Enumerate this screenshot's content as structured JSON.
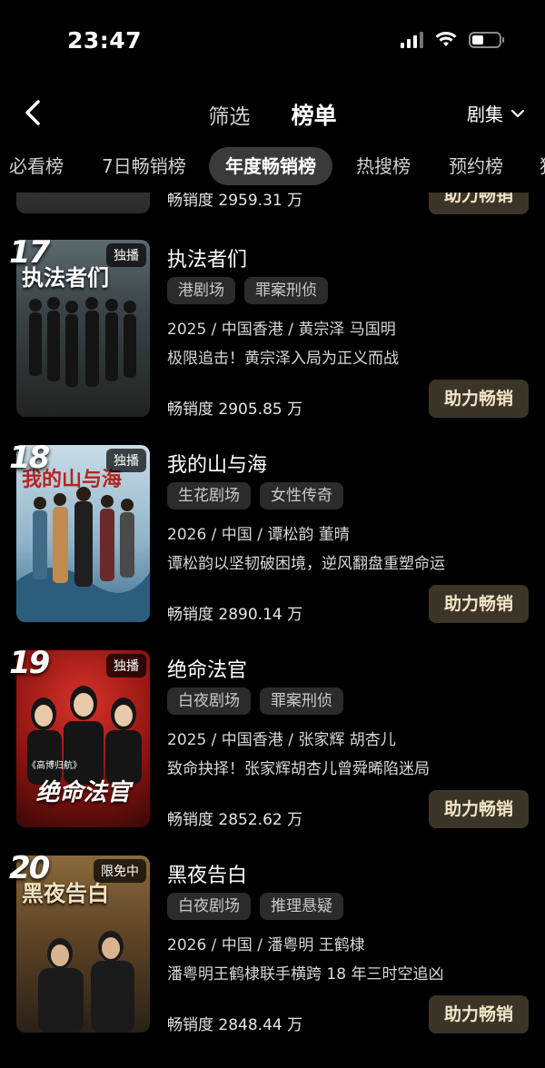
{
  "status": {
    "time": "23:47"
  },
  "nav": {
    "filter": "筛选",
    "title": "榜单",
    "category": "剧集"
  },
  "tabs": [
    "必看榜",
    "7日畅销榜",
    "年度畅销榜",
    "热搜榜",
    "预约榜",
    "猜"
  ],
  "partial_item": {
    "sales": "畅销度 2959.31 万",
    "button": "助力畅销"
  },
  "items": [
    {
      "rank": "17",
      "badge": "独播",
      "poster_text": "执法者们",
      "title": "执法者们",
      "tags": [
        "港剧场",
        "罪案刑侦"
      ],
      "meta": "2025 / 中国香港 / 黄宗泽  马国明",
      "desc": "极限追击！黄宗泽入局为正义而战",
      "sales": "畅销度 2905.85 万",
      "button": "助力畅销"
    },
    {
      "rank": "18",
      "badge": "独播",
      "poster_text": "我的山与海",
      "title": "我的山与海",
      "tags": [
        "生花剧场",
        "女性传奇"
      ],
      "meta": "2026 / 中国 / 谭松韵  董晴",
      "desc": "谭松韵以坚韧破困境，逆风翻盘重塑命运",
      "sales": "畅销度 2890.14 万",
      "button": "助力畅销"
    },
    {
      "rank": "19",
      "badge": "独播",
      "poster_text": "绝命法官",
      "poster_sub": "《高博归航》",
      "title": "绝命法官",
      "tags": [
        "白夜剧场",
        "罪案刑侦"
      ],
      "meta": "2025 / 中国香港 / 张家辉  胡杏儿",
      "desc": "致命抉择！张家辉胡杏儿曾舜晞陷迷局",
      "sales": "畅销度 2852.62 万",
      "button": "助力畅销"
    },
    {
      "rank": "20",
      "badge": "限免中",
      "poster_text": "黑夜告白",
      "title": "黑夜告白",
      "tags": [
        "白夜剧场",
        "推理悬疑"
      ],
      "meta": "2026 / 中国 / 潘粤明  王鹤棣",
      "desc": "潘粤明王鹤棣联手横跨 18 年三时空追凶",
      "sales": "畅销度 2848.44 万",
      "button": "助力畅销"
    }
  ]
}
